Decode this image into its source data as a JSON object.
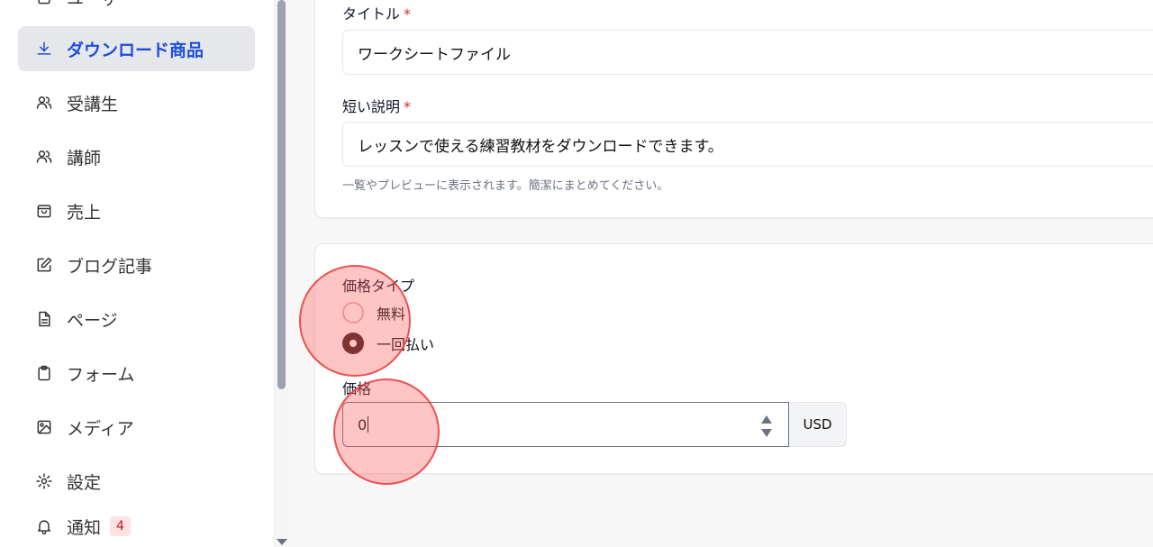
{
  "sidebar": {
    "items": [
      {
        "label": "ユーザー",
        "icon": "users-icon"
      },
      {
        "label": "ダウンロード商品",
        "icon": "download-icon",
        "active": true
      },
      {
        "label": "受講生",
        "icon": "users-icon"
      },
      {
        "label": "講師",
        "icon": "users-icon"
      },
      {
        "label": "売上",
        "icon": "shopping-bag-icon"
      },
      {
        "label": "ブログ記事",
        "icon": "edit-icon"
      },
      {
        "label": "ページ",
        "icon": "file-text-icon"
      },
      {
        "label": "フォーム",
        "icon": "clipboard-icon"
      },
      {
        "label": "メディア",
        "icon": "image-icon"
      },
      {
        "label": "設定",
        "icon": "gear-icon"
      },
      {
        "label": "通知",
        "icon": "bell-icon",
        "badge": "4"
      }
    ]
  },
  "form": {
    "title_label": "タイトル",
    "title_value": "ワークシートファイル",
    "desc_label": "短い説明",
    "desc_value": "レッスンで使える練習教材をダウンロードできます。",
    "desc_help": "一覧やプレビューに表示されます。簡潔にまとめてください。",
    "required_mark": "*",
    "price_type_label": "価格タイプ",
    "price_type_options": [
      {
        "label": "無料",
        "checked": false
      },
      {
        "label": "一回払い",
        "checked": true
      }
    ],
    "price_label": "価格",
    "price_value": "0",
    "currency": "USD"
  },
  "colors": {
    "accent": "#1d4ed8",
    "required": "#dc2626",
    "badge_bg": "#fde2e2",
    "highlight": "#ff5a5a"
  }
}
